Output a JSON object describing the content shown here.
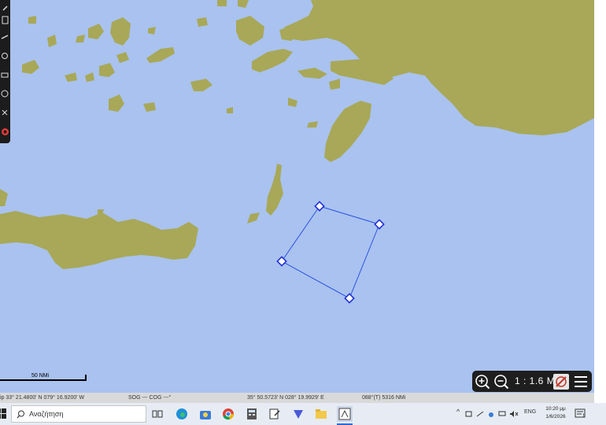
{
  "map": {
    "scale_bar_label": "50 NMi",
    "zoom_scale": "1 : 1.6 M",
    "colors": {
      "sea": "#a9c2ef",
      "land": "#a8a858",
      "route": "#2a52e0"
    },
    "route_waypoints": 4
  },
  "toolbar_icons": [
    "tool-icon",
    "page-icon",
    "measure-icon",
    "gear-icon",
    "print-icon",
    "help-icon",
    "info-icon",
    "lifebuoy-icon"
  ],
  "zoom": {
    "zoom_in_icon": "zoom-in-icon",
    "zoom_out_icon": "zoom-out-icon",
    "compass_icon": "compass-icon",
    "menu_icon": "hamburger-menu-icon"
  },
  "status": {
    "ship_position": "ip 33° 21.4800' N   079° 16.9200' W",
    "sog_cog": "SOG ---  COG ---°",
    "cursor_position": "35° 50.5723' N   028° 19.9929' E",
    "bearing_distance": "088°(T)   5316 NMi"
  },
  "taskbar": {
    "search_placeholder": "Αναζήτηση",
    "language": "ENG",
    "time": "10:20 μμ",
    "date": "1/6/2026",
    "notification_count": "1"
  }
}
